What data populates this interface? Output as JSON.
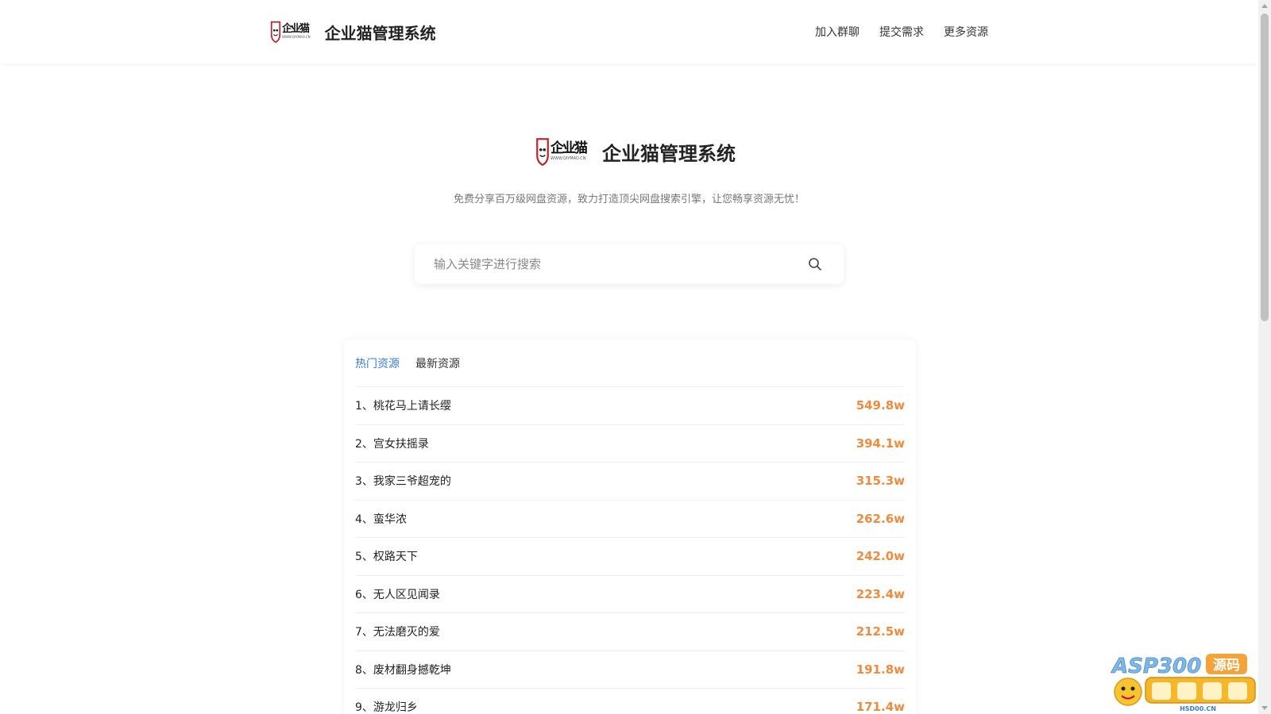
{
  "header": {
    "logo_main": "企业猫",
    "logo_sub": "WWW.QIYMAO.CN",
    "title": "企业猫管理系统",
    "nav": [
      "加入群聊",
      "提交需求",
      "更多资源"
    ]
  },
  "hero": {
    "logo_main": "企业猫",
    "logo_sub": "WWW.QIYMAO.CN",
    "title": "企业猫管理系统",
    "subtitle": "免费分享百万级网盘资源，致力打造顶尖网盘搜索引擎，让您畅享资源无忧！"
  },
  "search": {
    "placeholder": "输入关键字进行搜索",
    "icon": "search-icon"
  },
  "tabs": [
    {
      "label": "热门资源",
      "active": true
    },
    {
      "label": "最新资源",
      "active": false
    }
  ],
  "list": [
    {
      "name": "1、桃花马上请长缨",
      "count": "549.8w"
    },
    {
      "name": "2、宫女扶摇录",
      "count": "394.1w"
    },
    {
      "name": "3、我家三爷超宠的",
      "count": "315.3w"
    },
    {
      "name": "4、蛮华浓",
      "count": "262.6w"
    },
    {
      "name": "5、权路天下",
      "count": "242.0w"
    },
    {
      "name": "6、无人区见闻录",
      "count": "223.4w"
    },
    {
      "name": "7、无法磨灭的爱",
      "count": "212.5w"
    },
    {
      "name": "8、废材翻身撼乾坤",
      "count": "191.8w"
    },
    {
      "name": "9、游龙归乡",
      "count": "171.4w"
    }
  ],
  "watermark": {
    "brand": "ASP300",
    "tag": "源码",
    "url": "HSD00.CN"
  },
  "colors": {
    "accent": "#3a7bd5",
    "count": "#f08a3c",
    "logo_red": "#c0272d"
  }
}
